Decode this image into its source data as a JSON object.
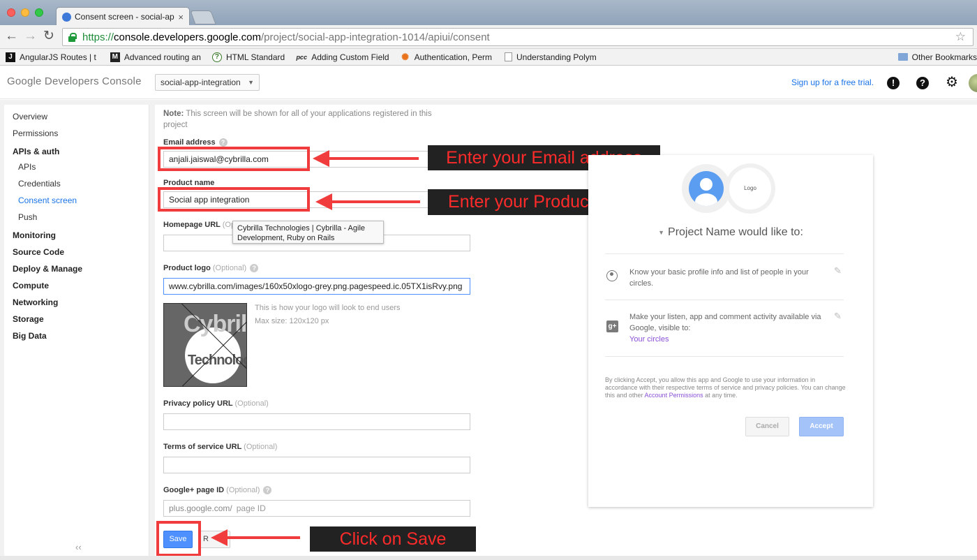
{
  "browser": {
    "tab_title": "Consent screen - social-ap",
    "tab_close": "×",
    "back": "←",
    "forward": "→",
    "reload": "↻",
    "star": "☆",
    "url_scheme": "https://",
    "url_host": "console.developers.google.com",
    "url_path": "/project/social-app-integration-1014/apiui/consent",
    "bookmarks": [
      {
        "label": "AngularJS Routes | t",
        "icon": "J"
      },
      {
        "label": "Advanced routing an",
        "icon": "M"
      },
      {
        "label": "HTML Standard",
        "icon": "?"
      },
      {
        "label": "Adding Custom Field",
        "icon": "pcc"
      },
      {
        "label": "Authentication, Perm",
        "icon": "✺"
      },
      {
        "label": "Understanding Polym",
        "icon": "page"
      }
    ],
    "other_bookmarks": "Other Bookmarks"
  },
  "header": {
    "brand": "Google Developers Console",
    "project": "social-app-integration",
    "caret": "▼",
    "signup": "Sign up for a free trial.",
    "feedback_icon": "!",
    "help_icon": "?",
    "settings_icon": "⚙"
  },
  "sidebar": {
    "items": [
      {
        "label": "Overview"
      },
      {
        "label": "Permissions"
      },
      {
        "label": "APIs & auth"
      },
      {
        "label": "APIs"
      },
      {
        "label": "Credentials"
      },
      {
        "label": "Consent screen"
      },
      {
        "label": "Push"
      },
      {
        "label": "Monitoring"
      },
      {
        "label": "Source Code"
      },
      {
        "label": "Deploy & Manage"
      },
      {
        "label": "Compute"
      },
      {
        "label": "Networking"
      },
      {
        "label": "Storage"
      },
      {
        "label": "Big Data"
      }
    ],
    "collapse": "‹‹"
  },
  "form": {
    "note_bold": "Note:",
    "note_text": " This screen will be shown for all of your applications registered in this project",
    "email_label": "Email address",
    "email_value": "anjali.jaiswal@cybrilla.com",
    "product_label": "Product name",
    "product_value": "Social app integration",
    "homepage_label": "Homepage URL",
    "homepage_optional": "(Op",
    "tooltip": "Cybrilla Technologies | Cybrilla - Agile Development, Ruby on Rails",
    "logo_label": "Product logo",
    "optional": "(Optional)",
    "logo_value": "www.cybrilla.com/images/160x50xlogo-grey.png.pagespeed.ic.05TX1isRvy.png",
    "logo_hint1": "This is how your logo will look to end users",
    "logo_hint2": "Max size: 120x120 px",
    "logo_word1": "Cybrilla",
    "logo_word2": "Technologies",
    "privacy_label": "Privacy policy URL",
    "tos_label": "Terms of service URL",
    "gplus_label": "Google+ page ID",
    "gplus_prefix": "plus.google.com/",
    "gplus_placeholder": "page ID",
    "help": "?",
    "save": "Save",
    "reset": "R"
  },
  "annotations": {
    "email": "Enter your Email address",
    "product": "Enter your Product name",
    "save": "Click on Save"
  },
  "preview": {
    "logo_text": "Logo",
    "title": "Project Name would like to:",
    "dropdown": "▼",
    "item1": "Know your basic profile info and list of people in your circles.",
    "item2_text": "Make your listen, app and comment activity available via Google, visible to:",
    "item2_link": "Your circles",
    "gplus_icon": "g+",
    "pencil": "✎",
    "legal_text": "By clicking Accept, you allow this app and Google to use your information in accordance with their respective terms of service and privacy policies. You can change this and other ",
    "legal_link": "Account Permissions",
    "legal_end": " at any time.",
    "cancel": "Cancel",
    "accept": "Accept"
  },
  "colors": {
    "annotation_red": "#f03c3c",
    "link_blue": "#1a73e8",
    "button_blue": "#4d90fe"
  }
}
